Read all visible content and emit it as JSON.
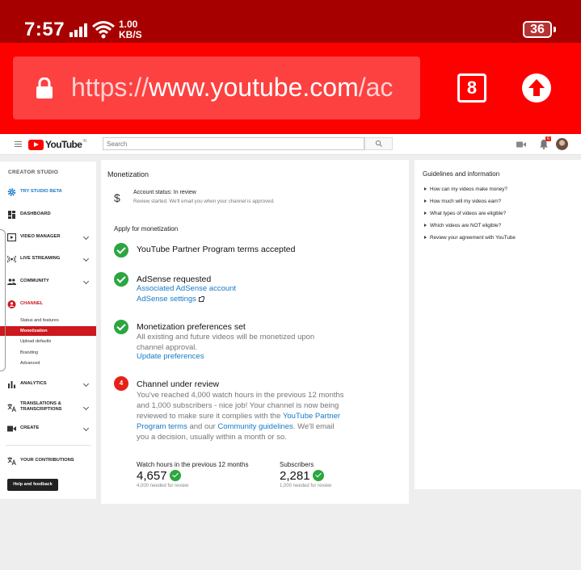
{
  "status_bar": {
    "time": "7:57",
    "speed_value": "1.00",
    "speed_unit": "KB/S",
    "battery": "36"
  },
  "browser": {
    "url_scheme": "https://",
    "url_host": "www.youtube.com",
    "url_path": "/ac",
    "tab_count": "8"
  },
  "header": {
    "logo_text": "YouTube",
    "logo_sup": "IN",
    "search_placeholder": "Search",
    "notification_count": "6"
  },
  "sidebar": {
    "title": "CREATOR STUDIO",
    "items": [
      {
        "label": "TRY STUDIO BETA"
      },
      {
        "label": "DASHBOARD"
      },
      {
        "label": "VIDEO MANAGER"
      },
      {
        "label": "LIVE STREAMING"
      },
      {
        "label": "COMMUNITY"
      },
      {
        "label": "CHANNEL"
      },
      {
        "label": "ANALYTICS"
      },
      {
        "label": "TRANSLATIONS &"
      },
      {
        "label": "CREATE"
      },
      {
        "label": "YOUR CONTRIBUTIONS"
      }
    ],
    "translations_line2": "TRANSCRIPTIONS",
    "channel_sub": [
      "Status and features",
      "Monetization",
      "Upload defaults",
      "Branding",
      "Advanced"
    ],
    "help_button": "Help and feedback"
  },
  "main": {
    "title": "Monetization",
    "account_status": "Account status: In review",
    "account_note": "Review started. We'll email you when your channel is approved.",
    "apply_title": "Apply for monetization",
    "steps": {
      "partner_terms": "YouTube Partner Program terms accepted",
      "adsense_title": "AdSense requested",
      "adsense_link1": "Associated AdSense account",
      "adsense_link2": "AdSense settings",
      "prefs_title": "Monetization preferences set",
      "prefs_text": "All existing and future videos will be monetized upon channel approval.",
      "prefs_link": "Update preferences",
      "review_num": "4",
      "review_title": "Channel under review",
      "review_text1": "You've reached 4,000 watch hours in the previous 12 months and 1,000 subscribers - nice job! Your channel is now being reviewed to make sure it complies with the ",
      "review_link1": "YouTube Partner Program terms",
      "review_text2": " and our ",
      "review_link2": "Community guidelines",
      "review_text3": ". We'll email you a decision, usually within a month or so."
    },
    "stats": {
      "watch_label": "Watch hours in the previous 12 months",
      "watch_value": "4,657",
      "watch_note": "4,000 needed for review",
      "subs_label": "Subscribers",
      "subs_value": "2,281",
      "subs_note": "1,000 needed for review"
    }
  },
  "guidelines": {
    "title": "Guidelines and information",
    "items": [
      "How can my videos make money?",
      "How much will my videos earn?",
      "What types of videos are eligible?",
      "Which videos are NOT eligible?",
      "Review your agreement with YouTube"
    ]
  }
}
